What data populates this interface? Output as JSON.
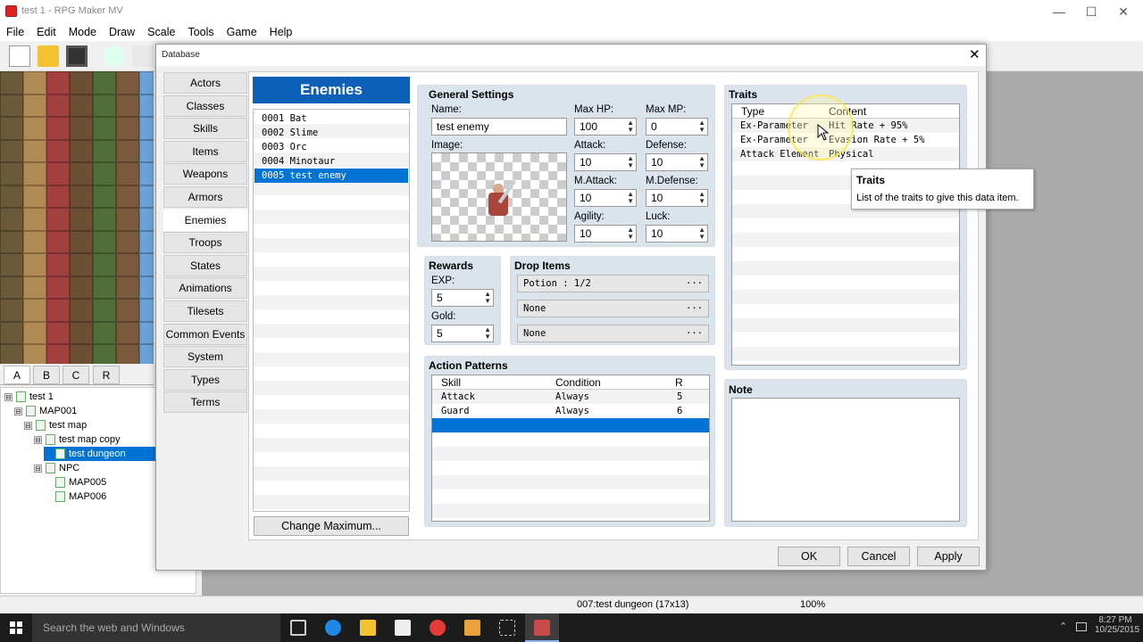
{
  "window": {
    "title": "test 1 - RPG Maker MV",
    "controls": [
      "—",
      "☐",
      "✕"
    ]
  },
  "menu": [
    "File",
    "Edit",
    "Mode",
    "Draw",
    "Scale",
    "Tools",
    "Game",
    "Help"
  ],
  "tile_tabs": [
    "A",
    "B",
    "C",
    "R"
  ],
  "map_tree": [
    {
      "label": "test 1",
      "level": 0,
      "expand": "⊟",
      "selected": false
    },
    {
      "label": "MAP001",
      "level": 1,
      "expand": "⊟",
      "selected": false
    },
    {
      "label": "test map",
      "level": 2,
      "expand": "⊟",
      "selected": false
    },
    {
      "label": "test map copy",
      "level": 3,
      "expand": "⊟",
      "selected": false
    },
    {
      "label": "test dungeon",
      "level": 4,
      "expand": "",
      "selected": true
    },
    {
      "label": "NPC",
      "level": 3,
      "expand": "⊟",
      "selected": false
    },
    {
      "label": "MAP005",
      "level": 4,
      "expand": "",
      "selected": false
    },
    {
      "label": "MAP006",
      "level": 4,
      "expand": "",
      "selected": false
    }
  ],
  "status": {
    "map": "007:test dungeon (17x13)",
    "zoom": "100%"
  },
  "taskbar": {
    "search": "Search the web and Windows",
    "time": "8:27 PM",
    "date": "10/25/2015"
  },
  "dialog": {
    "title": "Database",
    "close": "✕",
    "categories": [
      "Actors",
      "Classes",
      "Skills",
      "Items",
      "Weapons",
      "Armors",
      "Enemies",
      "Troops",
      "States",
      "Animations",
      "Tilesets",
      "Common Events",
      "System",
      "Types",
      "Terms"
    ],
    "selected_category": "Enemies",
    "list_title": "Enemies",
    "enemies": [
      "0001 Bat",
      "0002 Slime",
      "0003 Orc",
      "0004 Minotaur",
      "0005 test enemy"
    ],
    "selected_enemy": 4,
    "change_max": "Change Maximum...",
    "general": {
      "title": "General Settings",
      "name_label": "Name:",
      "name": "test enemy",
      "image_label": "Image:",
      "maxhp_label": "Max HP:",
      "maxhp": "100",
      "maxmp_label": "Max MP:",
      "maxmp": "0",
      "atk_label": "Attack:",
      "atk": "10",
      "def_label": "Defense:",
      "def": "10",
      "matk_label": "M.Attack:",
      "matk": "10",
      "mdef_label": "M.Defense:",
      "mdef": "10",
      "agi_label": "Agility:",
      "agi": "10",
      "luk_label": "Luck:",
      "luk": "10"
    },
    "rewards": {
      "title": "Rewards",
      "exp_label": "EXP:",
      "exp": "5",
      "gold_label": "Gold:",
      "gold": "5"
    },
    "drops": {
      "title": "Drop Items",
      "items": [
        "Potion : 1/2",
        "None",
        "None"
      ],
      "more": "···"
    },
    "actions": {
      "title": "Action Patterns",
      "headers": [
        "Skill",
        "Condition",
        "R"
      ],
      "rows": [
        [
          "Attack",
          "Always",
          "5"
        ],
        [
          "Guard",
          "Always",
          "6"
        ]
      ]
    },
    "traits": {
      "title": "Traits",
      "headers": [
        "Type",
        "Content"
      ],
      "rows": [
        [
          "Ex-Parameter",
          "Hit Rate + 95%"
        ],
        [
          "Ex-Parameter",
          "Evasion Rate + 5%"
        ],
        [
          "Attack Element",
          "Physical"
        ]
      ]
    },
    "tooltip": {
      "title": "Traits",
      "text": "List of the traits to give this data item."
    },
    "note": {
      "title": "Note"
    },
    "buttons": {
      "ok": "OK",
      "cancel": "Cancel",
      "apply": "Apply"
    }
  }
}
